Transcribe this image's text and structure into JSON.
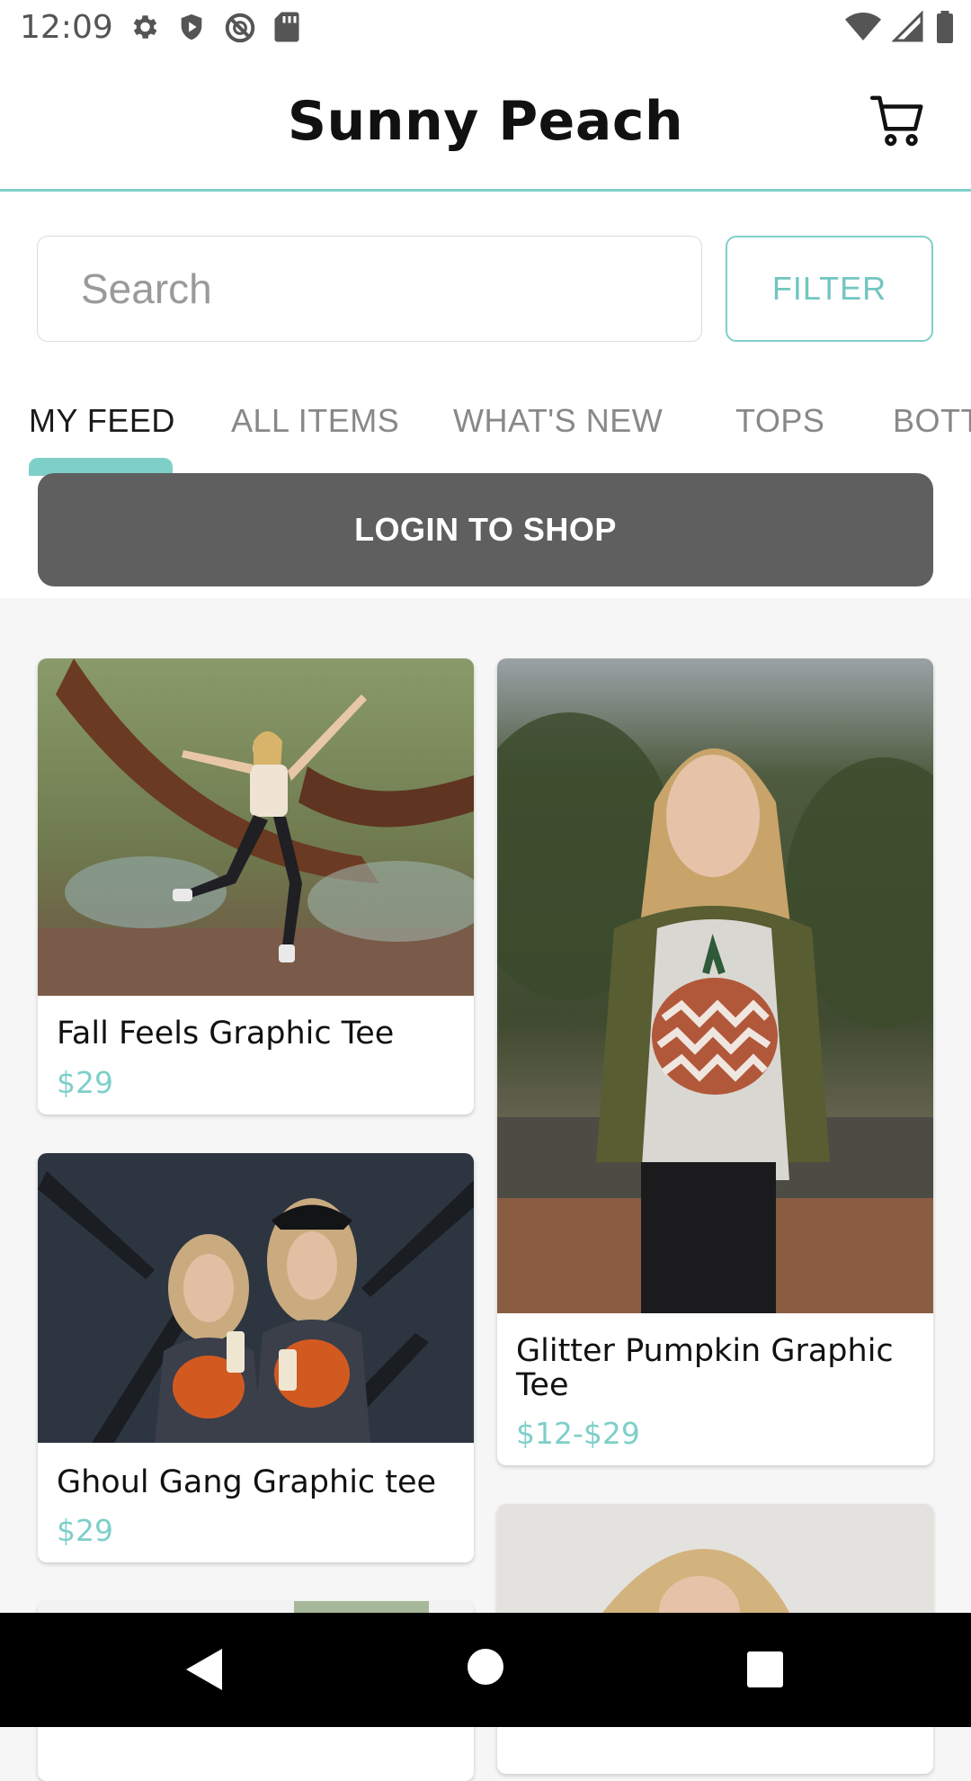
{
  "status_bar": {
    "time": "12:09",
    "left_icons": [
      "gear-icon",
      "shield-icon",
      "blocked-circle-icon",
      "sd-card-icon"
    ],
    "right_icons": [
      "wifi-icon",
      "cell-signal-icon",
      "battery-icon"
    ]
  },
  "header": {
    "brand": "Sunny Peach",
    "cart_icon": "cart-icon"
  },
  "search": {
    "placeholder": "Search",
    "filter_label": "FILTER"
  },
  "tabs": [
    {
      "label": "MY FEED",
      "active": true
    },
    {
      "label": "ALL ITEMS",
      "active": false
    },
    {
      "label": "WHAT'S NEW",
      "active": false
    },
    {
      "label": "TOPS",
      "active": false
    },
    {
      "label": "BOTTOMS",
      "active": false
    }
  ],
  "login_button": "LOGIN TO SHOP",
  "products": [
    {
      "title": "Fall Feels Graphic Tee",
      "price": "$29"
    },
    {
      "title": "Glitter Pumpkin Graphic Tee",
      "price": "$12-$29"
    },
    {
      "title": "Ghoul Gang Graphic tee",
      "price": "$29"
    }
  ],
  "colors": {
    "accent": "#7fcfc9",
    "login_bg": "#5f5f5f"
  },
  "nav_bar": [
    "back-icon",
    "home-icon",
    "recents-icon"
  ]
}
